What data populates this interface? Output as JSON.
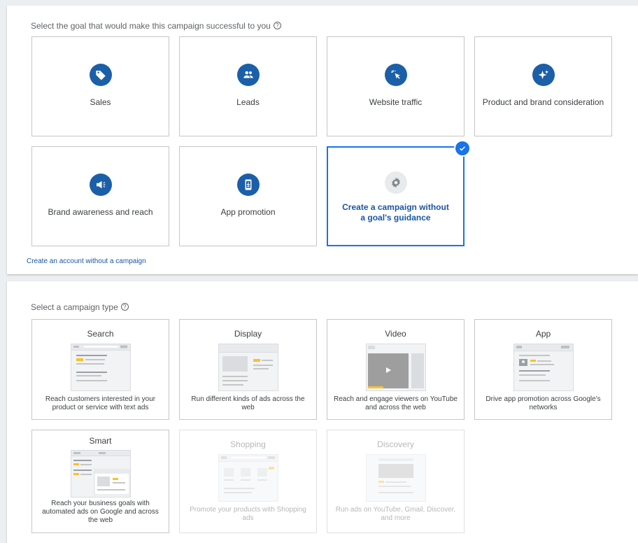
{
  "goal_section": {
    "title": "Select the goal that would make this campaign successful to you",
    "help_glyph": "?",
    "goals": [
      {
        "label": "Sales",
        "icon": "tag-icon"
      },
      {
        "label": "Leads",
        "icon": "people-icon"
      },
      {
        "label": "Website traffic",
        "icon": "cursor-click-icon"
      },
      {
        "label": "Product and brand consideration",
        "icon": "sparkle-icon"
      },
      {
        "label": "Brand awareness and reach",
        "icon": "megaphone-icon"
      },
      {
        "label": "App promotion",
        "icon": "phone-download-icon"
      },
      {
        "label": "Create a campaign without a goal's guidance",
        "icon": "gear-icon",
        "selected": true
      }
    ],
    "create_account_link": "Create an account without a campaign"
  },
  "type_section": {
    "title": "Select a campaign type",
    "help_glyph": "?",
    "types": [
      {
        "title": "Search",
        "description": "Reach customers interested in your product or service with text ads",
        "enabled": true
      },
      {
        "title": "Display",
        "description": "Run different kinds of ads across the web",
        "enabled": true
      },
      {
        "title": "Video",
        "description": "Reach and engage viewers on YouTube and across the web",
        "enabled": true
      },
      {
        "title": "App",
        "description": "Drive app promotion across Google's networks",
        "enabled": true
      },
      {
        "title": "Smart",
        "description": "Reach your business goals with automated ads on Google and across the web",
        "enabled": true
      },
      {
        "title": "Shopping",
        "description": "Promote your products with Shopping ads",
        "enabled": false
      },
      {
        "title": "Discovery",
        "description": "Run ads on YouTube, Gmail, Discover, and more",
        "enabled": false
      }
    ]
  },
  "colors": {
    "accent": "#1a73e8",
    "icon_circle": "#1b5fa8",
    "link": "#1a56a5",
    "placeholder_yellow": "#fbc02d"
  }
}
